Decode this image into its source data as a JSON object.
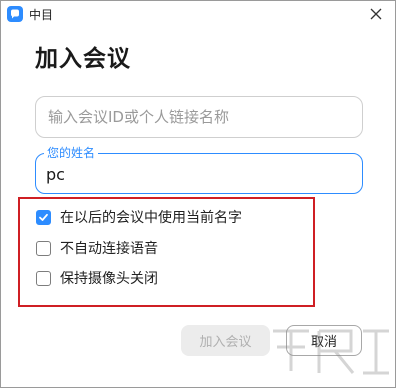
{
  "window": {
    "title": "中目",
    "heading": "加入会议"
  },
  "form": {
    "meeting_id_placeholder": "输入会议ID或个人链接名称",
    "meeting_id_value": "",
    "name_label": "您的姓名",
    "name_value": "pc"
  },
  "options": [
    {
      "label": "在以后的会议中使用当前名字",
      "checked": true
    },
    {
      "label": "不自动连接语音",
      "checked": false
    },
    {
      "label": "保持摄像头关闭",
      "checked": false
    }
  ],
  "buttons": {
    "join_label": "加入会议",
    "join_enabled": false,
    "cancel_label": "取消"
  },
  "icons": {
    "app": "app-logo-icon",
    "close": "close-icon",
    "check": "checkmark-icon"
  },
  "colors": {
    "accent": "#2d8cff",
    "highlight": "#cf1f24",
    "disabled_bg": "#ececec",
    "disabled_text": "#b0b0b0"
  }
}
